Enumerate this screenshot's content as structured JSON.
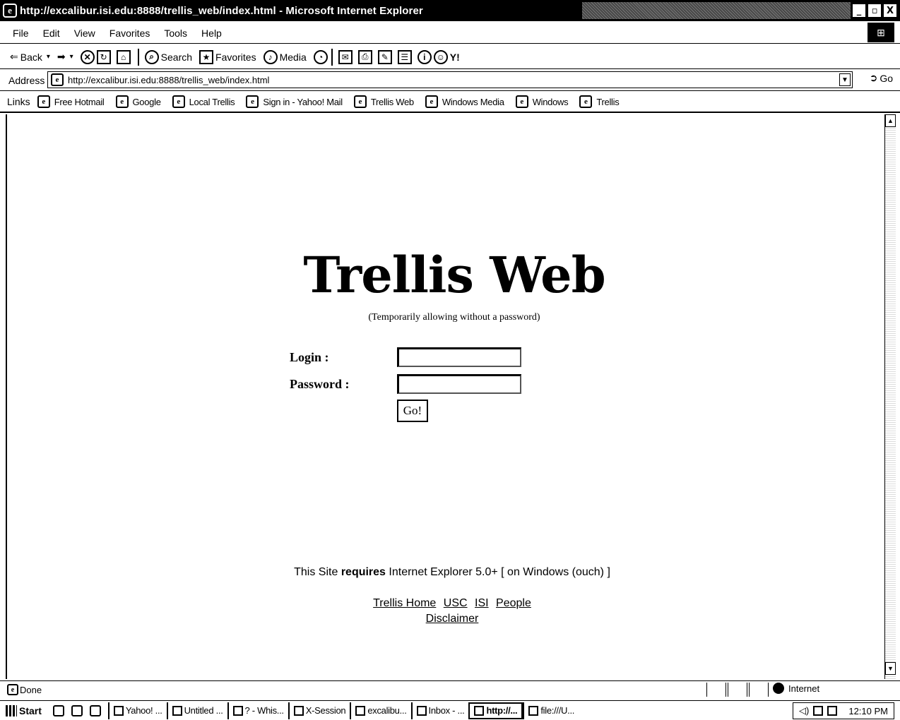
{
  "window": {
    "title": "http://excalibur.isi.edu:8888/trellis_web/index.html - Microsoft Internet Explorer",
    "controls": [
      "_",
      "ɑ",
      "X"
    ]
  },
  "menu": {
    "items": [
      "File",
      "Edit",
      "View",
      "Favorites",
      "Tools",
      "Help"
    ]
  },
  "toolbar": {
    "back": "Back",
    "search": "Search",
    "favorites": "Favorites",
    "media": "Media"
  },
  "address": {
    "label": "Address",
    "url": "http://excalibur.isi.edu:8888/trellis_web/index.html",
    "go": "Go"
  },
  "links": {
    "label": "Links",
    "items": [
      "Free Hotmail",
      "Google",
      "Local Trellis",
      "Sign in - Yahoo! Mail",
      "Trellis Web",
      "Windows Media",
      "Windows",
      "Trellis"
    ]
  },
  "page": {
    "brand": "Trellis Web",
    "subtitle": "(Temporarily allowing without a password)",
    "login_label": "Login :",
    "password_label": "Password :",
    "login_value": "",
    "password_value": "",
    "submit": "Go!",
    "requirement_pre": "This Site",
    "requirement_bold": "requires",
    "requirement_post": "Internet Explorer 5.0+ [ on Windows (ouch) ]",
    "footer_links": [
      "Trellis Home",
      "USC",
      "ISI",
      "People"
    ],
    "disclaimer": "Disclaimer"
  },
  "status": {
    "text": "Done",
    "zone": "Internet"
  },
  "taskbar": {
    "start": "Start",
    "tasks": [
      "Yahoo! ...",
      "Untitled ...",
      "? - Whis...",
      "X-Session",
      "excalibu...",
      "Inbox - ...",
      "http://...",
      "file:///U..."
    ],
    "active_index": 6,
    "clock": "12:10 PM"
  }
}
